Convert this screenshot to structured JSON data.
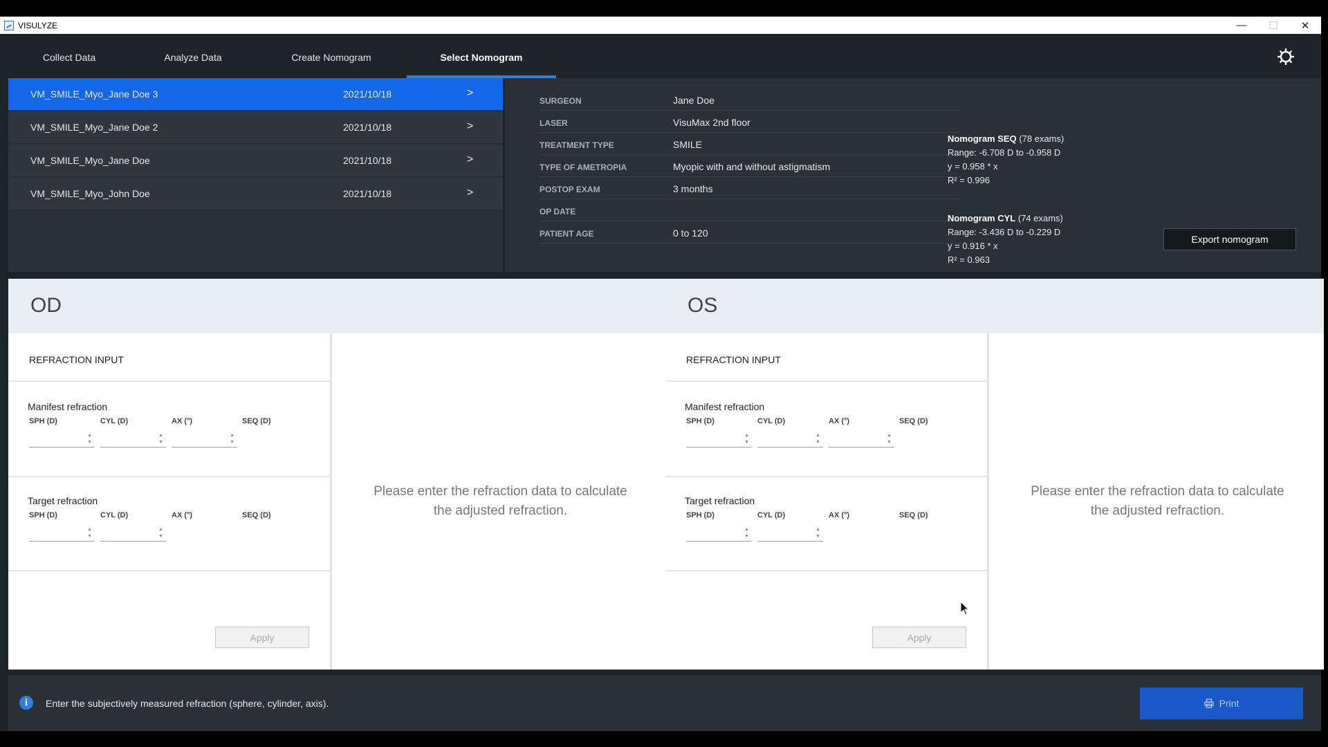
{
  "window": {
    "title": "VISULYZE",
    "minimize": "—",
    "maximize": "☐",
    "close": "✕"
  },
  "nav": {
    "tabs": [
      {
        "label": "Collect Data"
      },
      {
        "label": "Analyze Data"
      },
      {
        "label": "Create Nomogram"
      },
      {
        "label": "Select Nomogram"
      }
    ],
    "active": "Select Nomogram"
  },
  "nomograms": [
    {
      "name": "VM_SMILE_Myo_Jane Doe 3",
      "date": "2021/10/18",
      "chevron": ">"
    },
    {
      "name": "VM_SMILE_Myo_Jane Doe 2",
      "date": "2021/10/18",
      "chevron": ">"
    },
    {
      "name": "VM_SMILE_Myo_Jane Doe",
      "date": "2021/10/18",
      "chevron": ">"
    },
    {
      "name": "VM_SMILE_Myo_John Doe",
      "date": "2021/10/18",
      "chevron": ">"
    }
  ],
  "details": [
    {
      "label": "SURGEON",
      "value": "Jane Doe"
    },
    {
      "label": "LASER",
      "value": "VisuMax 2nd floor"
    },
    {
      "label": "TREATMENT TYPE",
      "value": "SMILE"
    },
    {
      "label": "TYPE OF AMETROPIA",
      "value": "Myopic with and without astigmatism"
    },
    {
      "label": "POSTOP EXAM",
      "value": "3 months"
    },
    {
      "label": "OP DATE",
      "value": ""
    },
    {
      "label": "PATIENT AGE",
      "value": "0 to 120"
    }
  ],
  "nomogram_seq": {
    "title": "Nomogram SEQ",
    "exams": "(78 exams)",
    "range": "Range: -6.708 D to -0.958 D",
    "formula": "y = 0.958 * x",
    "r2": "R² = 0.996"
  },
  "nomogram_cyl": {
    "title": "Nomogram CYL",
    "exams": "(74 exams)",
    "range": "Range: -3.436 D to -0.229 D",
    "formula": "y = 0.916 * x",
    "r2": "R² = 0.963"
  },
  "export_label": "Export nomogram",
  "eyes": [
    {
      "title": "OD"
    },
    {
      "title": "OS"
    }
  ],
  "refraction": {
    "section_title": "REFRACTION INPUT",
    "manifest_title": "Manifest refraction",
    "target_title": "Target refraction",
    "col_sph": "SPH (D)",
    "col_cyl": "CYL (D)",
    "col_ax": "AX (°)",
    "col_seq": "SEQ (D)",
    "apply_label": "Apply"
  },
  "result_message": "Please enter the refraction data to calculate the adjusted refraction.",
  "footer": {
    "info": "Enter the subjectively measured refraction (sphere, cylinder, axis).",
    "print_label": "Print"
  },
  "colors": {
    "accent": "#2f7de1",
    "selected_row": "#1467e6",
    "panel_dark": "#2a3136"
  }
}
